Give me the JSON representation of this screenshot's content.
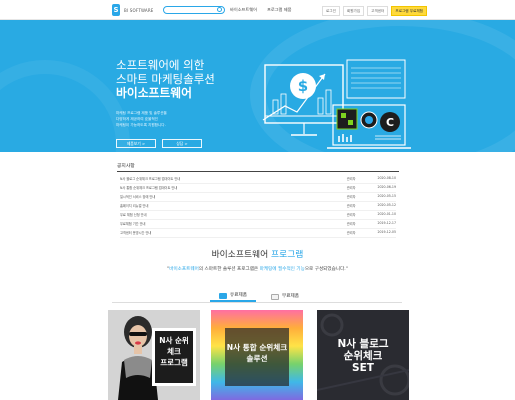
{
  "header": {
    "logo_text": "BI SOFTWARE",
    "nav": [
      "바이소프트웨어",
      "프로그램 제품"
    ],
    "util_buttons": [
      "로그인",
      "회원가입",
      "고객센터",
      "프로그램 무료체험"
    ]
  },
  "hero": {
    "line1": "소프트웨어에 의한",
    "line2": "스마트 마케팅솔루션",
    "line3": "바이소프트웨어",
    "desc": [
      "마케팅 프로그램 제품 및 솔루션을",
      "다양하게 제공하여 효율적인",
      "마케팅이 가능하도록 지원합니다."
    ],
    "btn1": "제품보기 >",
    "btn2": "상담 >"
  },
  "notices": {
    "title": "공지사항",
    "rows": [
      {
        "title": "N사 블로그 순위체크 프로그램 업데이트 안내",
        "author": "관리자",
        "date": "2020-08-10"
      },
      {
        "title": "N사 통합 순위체크 프로그램 업데이트 안내",
        "author": "관리자",
        "date": "2020-06-19"
      },
      {
        "title": "일시적인 서비스 장애 안내",
        "author": "관리자",
        "date": "2020-05-15"
      },
      {
        "title": "홈페이지 리뉴얼 안내",
        "author": "관리자",
        "date": "2020-05-12"
      },
      {
        "title": "무료 체험 신청 안내",
        "author": "관리자",
        "date": "2020-01-10"
      },
      {
        "title": "무료체험 기간 안내",
        "author": "관리자",
        "date": "2019-12-17"
      },
      {
        "title": "고객센터 운영시간 안내",
        "author": "관리자",
        "date": "2019-12-05"
      }
    ]
  },
  "programs": {
    "title_a": "바이소프트웨어",
    "title_b": " 프로그램",
    "sub_a": "\"",
    "sub_brand": "바이소프트웨어",
    "sub_mid": "의 스마트한 솔루션 프로그램은 ",
    "sub_hl": "마케팅에 필수적인 기능",
    "sub_end": "으로 구성되었습니다.\"",
    "tabs": [
      "유료제품",
      "무료제품"
    ],
    "cards": [
      {
        "lines": [
          "N사 순위",
          "체크",
          "프로그램"
        ]
      },
      {
        "lines": [
          "N사 통합 순위체크",
          "솔루션"
        ]
      },
      {
        "lines": [
          "N사 블로그",
          "순위체크",
          "SET"
        ]
      }
    ]
  }
}
